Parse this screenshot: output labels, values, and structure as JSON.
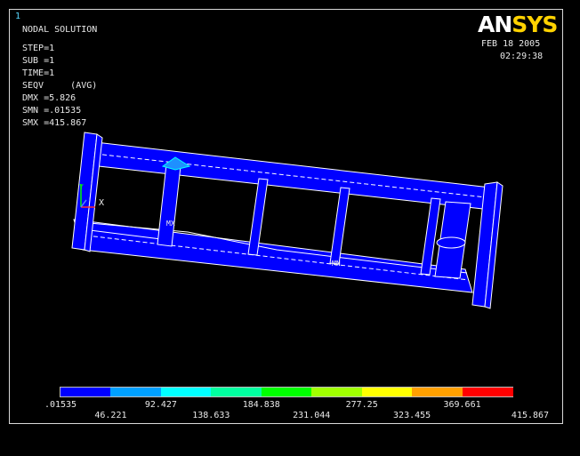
{
  "window_number": "1",
  "logo": {
    "part1": "AN",
    "part2": "SYS"
  },
  "solution_info": {
    "title": "NODAL SOLUTION",
    "step": "STEP=1",
    "sub": "SUB =1",
    "time": "TIME=1",
    "result": "SEQV     (AVG)",
    "dmx": "DMX =5.826",
    "smn": "SMN =.01535",
    "smx": "SMX =415.867"
  },
  "date": "FEB 18 2005",
  "time": "02:29:38",
  "markers": {
    "mn": "MN",
    "mx": "MX",
    "x_axis": "X",
    "y_axis": "Y"
  },
  "model_colors": {
    "body": "#0000ff",
    "edges": "#ffffff",
    "hotspot": "#1e90ff"
  },
  "legend": {
    "colors": [
      "#0000ff",
      "#00a0ff",
      "#00ffff",
      "#00ffa0",
      "#00ff00",
      "#a0ff00",
      "#ffff00",
      "#ffa000",
      "#ff0000"
    ],
    "labels_top": [
      ".01535",
      "92.427",
      "184.838",
      "277.25",
      "369.661"
    ],
    "labels_bottom": [
      "46.221",
      "138.633",
      "231.044",
      "323.455",
      "415.867"
    ]
  }
}
